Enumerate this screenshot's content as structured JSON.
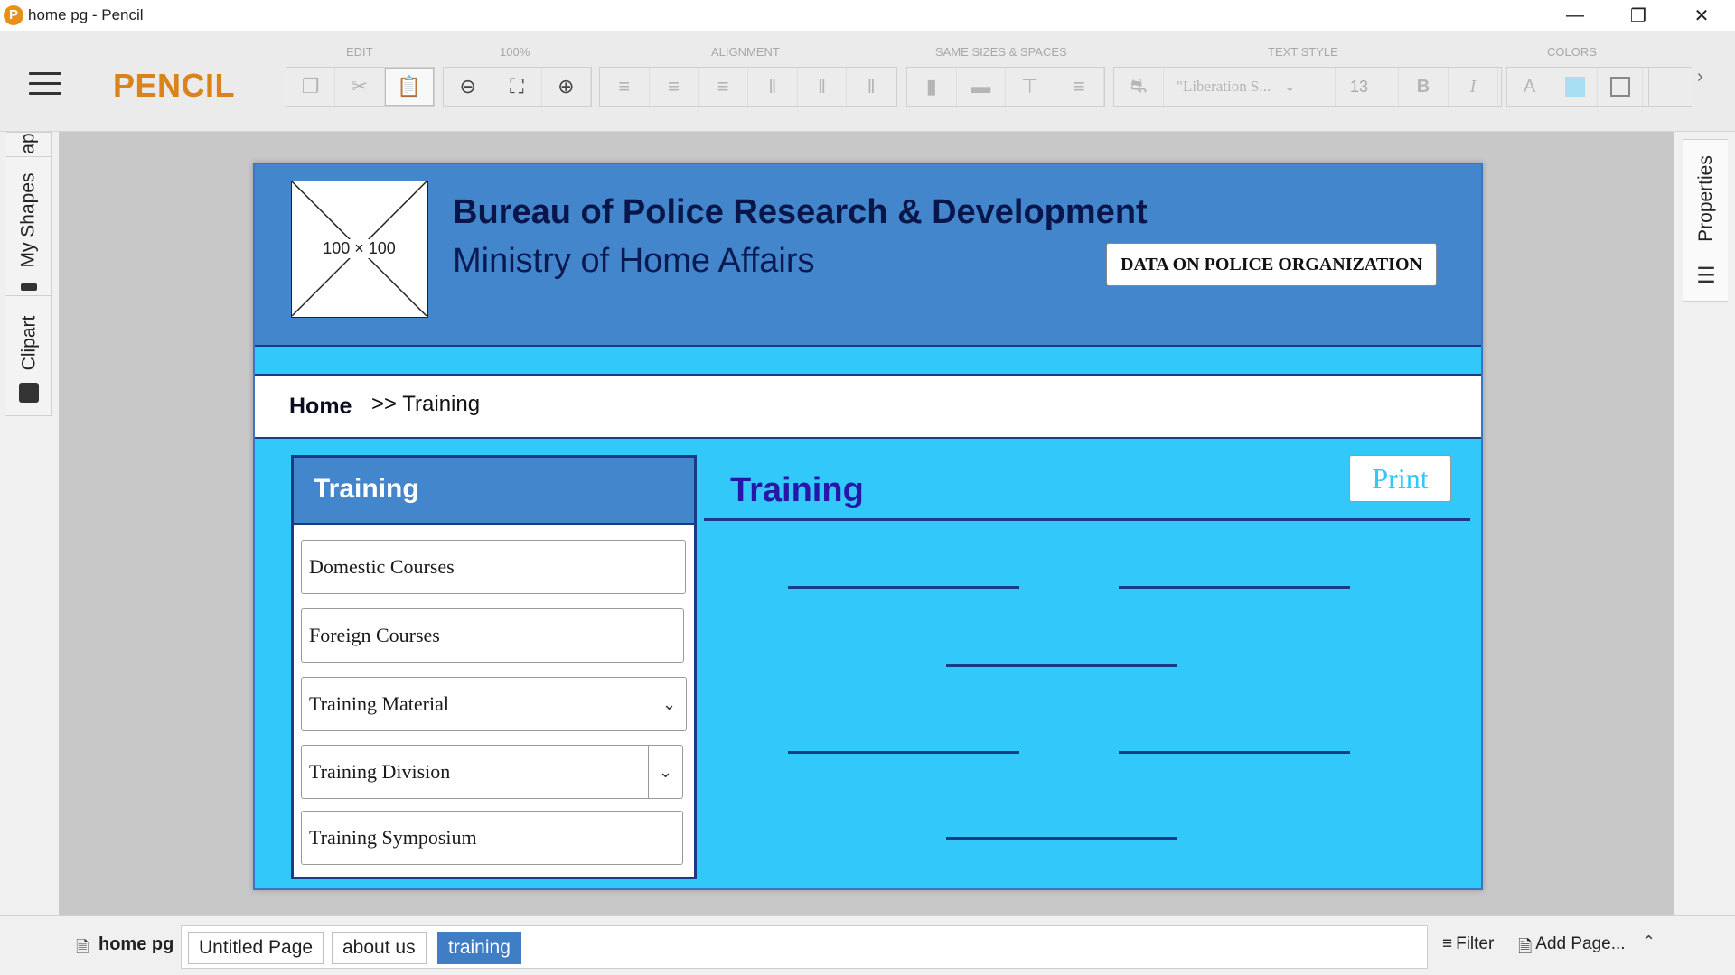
{
  "window": {
    "title": "home pg - Pencil",
    "app_icon": "P"
  },
  "toolbar": {
    "brand": "PENCIL",
    "groups": [
      "EDIT",
      "100%",
      "ALIGNMENT",
      "SAME SIZES & SPACES",
      "TEXT STYLE",
      "COLORS"
    ],
    "font_family": "\"Liberation S...",
    "font_size": "13",
    "bold": "B",
    "italic": "I",
    "text_color": "A"
  },
  "left_dock": {
    "tabs": [
      "ap",
      "My Shapes",
      "Clipart"
    ]
  },
  "right_dock": {
    "tabs": [
      "Properties"
    ]
  },
  "mockup": {
    "logo_placeholder": "100 × 100",
    "org_name": "Bureau of Police Research & Development",
    "ministry": "Ministry of Home Affairs",
    "data_button": "DATA ON POLICE ORGANIZATION",
    "breadcrumb": {
      "home": "Home",
      "current": ">> Training"
    },
    "sidenav": {
      "title": "Training",
      "items": [
        {
          "label": "Domestic Courses",
          "dropdown": false
        },
        {
          "label": "Foreign Courses",
          "dropdown": false
        },
        {
          "label": "Training Material",
          "dropdown": true
        },
        {
          "label": "Training Division",
          "dropdown": true
        },
        {
          "label": "Training Symposium",
          "dropdown": false
        }
      ]
    },
    "main": {
      "title": "Training",
      "print_button": "Print"
    }
  },
  "pagebar": {
    "current_page": "home pg",
    "tabs": [
      "Untitled Page",
      "about us",
      "training"
    ],
    "active_tab": "training",
    "filter": "Filter",
    "add_page": "Add Page..."
  },
  "colors": {
    "brand": "#d9831a",
    "header_blue": "#4386cc",
    "page_cyan": "#33c8fa",
    "navy": "#1a3a84",
    "title_purple": "#2518a8",
    "active_tab": "#3f7ec4"
  }
}
